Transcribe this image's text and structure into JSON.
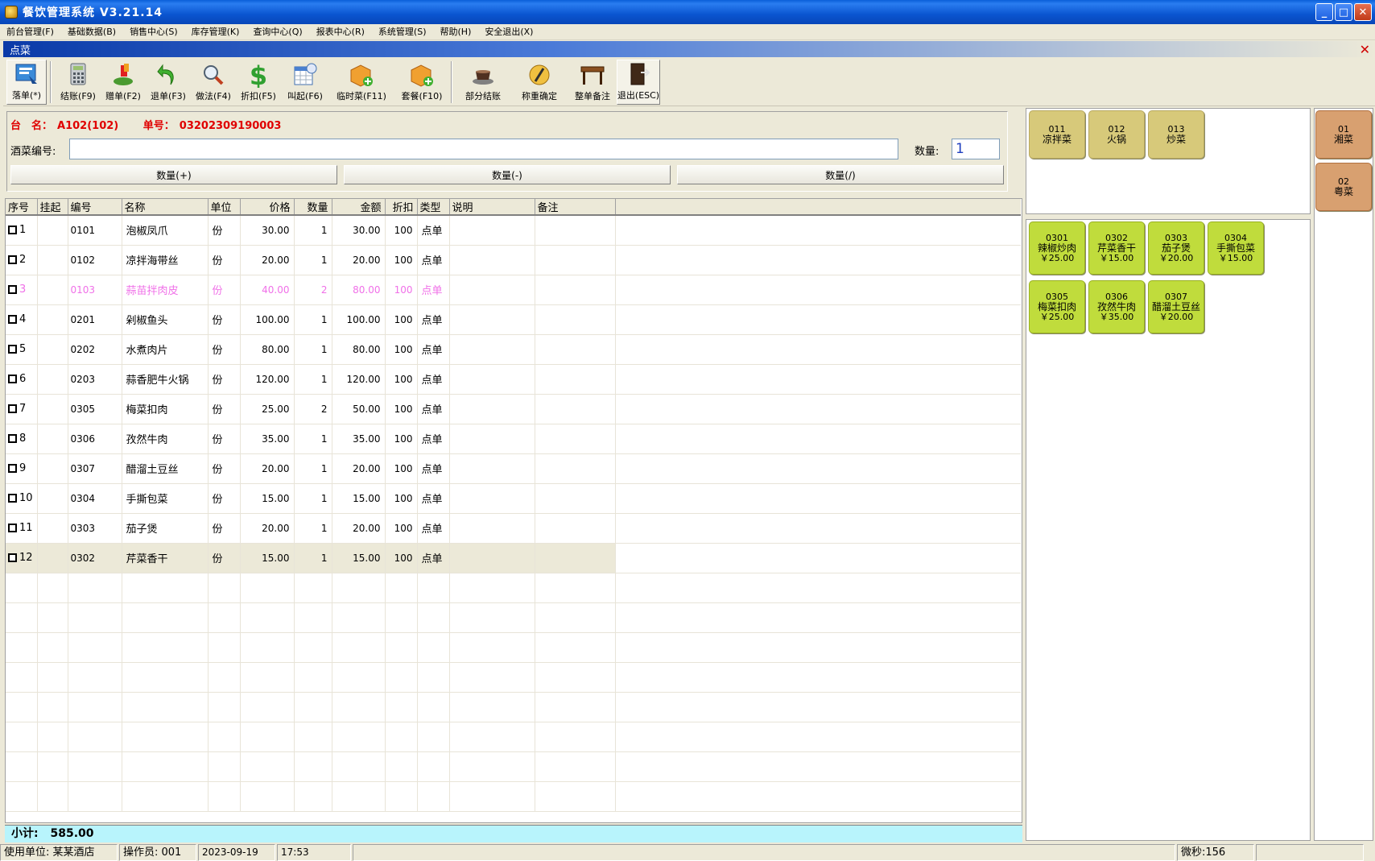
{
  "window": {
    "title": "餐饮管理系统 V3.21.14"
  },
  "menu": [
    "前台管理(F)",
    "基础数据(B)",
    "销售中心(S)",
    "库存管理(K)",
    "查询中心(Q)",
    "报表中心(R)",
    "系统管理(S)",
    "帮助(H)",
    "安全退出(X)"
  ],
  "child": {
    "title": "点菜"
  },
  "toolbar": {
    "buttons": [
      {
        "label": "落单(*)",
        "icon": "order-icon"
      },
      {
        "label": "结账(F9)",
        "icon": "calculator-icon"
      },
      {
        "label": "赠单(F2)",
        "icon": "gift-icon"
      },
      {
        "label": "退单(F3)",
        "icon": "undo-arrow-icon"
      },
      {
        "label": "做法(F4)",
        "icon": "magnifier-icon"
      },
      {
        "label": "折扣(F5)",
        "icon": "dollar-icon"
      },
      {
        "label": "叫起(F6)",
        "icon": "calendar-icon"
      },
      {
        "label": "临时菜(F11)",
        "icon": "box-add-icon"
      },
      {
        "label": "套餐(F10)",
        "icon": "package-add-icon"
      },
      {
        "label": "部分结账",
        "icon": "teacup-icon"
      },
      {
        "label": "称重确定",
        "icon": "scale-icon"
      },
      {
        "label": "整单备注",
        "icon": "table-icon"
      },
      {
        "label": "退出(ESC)",
        "icon": "exit-door-icon"
      }
    ]
  },
  "order": {
    "table_label": "台　名：",
    "table_value": "A102(102)",
    "number_label": "单号：",
    "number_value": "03202309190003",
    "dish_code_label": "酒菜编号:",
    "dish_code_value": "",
    "qty_label": "数量:",
    "qty_value": "1",
    "btn_plus": "数量(+)",
    "btn_minus": "数量(-)",
    "btn_div": "数量(/)"
  },
  "grid": {
    "columns": [
      "序号",
      "挂起",
      "编号",
      "名称",
      "单位",
      "价格",
      "数量",
      "金额",
      "折扣",
      "类型",
      "说明",
      "备注"
    ],
    "rows": [
      {
        "no": "1",
        "code": "0101",
        "name": "泡椒凤爪",
        "unit": "份",
        "price": "30.00",
        "qty": "1",
        "amount": "30.00",
        "discount": "100",
        "type": "点单"
      },
      {
        "no": "2",
        "code": "0102",
        "name": "凉拌海带丝",
        "unit": "份",
        "price": "20.00",
        "qty": "1",
        "amount": "20.00",
        "discount": "100",
        "type": "点单"
      },
      {
        "no": "3",
        "code": "0103",
        "name": "蒜苗拌肉皮",
        "unit": "份",
        "price": "40.00",
        "qty": "2",
        "amount": "80.00",
        "discount": "100",
        "type": "点单",
        "style": "pink"
      },
      {
        "no": "4",
        "code": "0201",
        "name": "剁椒鱼头",
        "unit": "份",
        "price": "100.00",
        "qty": "1",
        "amount": "100.00",
        "discount": "100",
        "type": "点单"
      },
      {
        "no": "5",
        "code": "0202",
        "name": "水煮肉片",
        "unit": "份",
        "price": "80.00",
        "qty": "1",
        "amount": "80.00",
        "discount": "100",
        "type": "点单"
      },
      {
        "no": "6",
        "code": "0203",
        "name": "蒜香肥牛火锅",
        "unit": "份",
        "price": "120.00",
        "qty": "1",
        "amount": "120.00",
        "discount": "100",
        "type": "点单"
      },
      {
        "no": "7",
        "code": "0305",
        "name": "梅菜扣肉",
        "unit": "份",
        "price": "25.00",
        "qty": "2",
        "amount": "50.00",
        "discount": "100",
        "type": "点单"
      },
      {
        "no": "8",
        "code": "0306",
        "name": "孜然牛肉",
        "unit": "份",
        "price": "35.00",
        "qty": "1",
        "amount": "35.00",
        "discount": "100",
        "type": "点单"
      },
      {
        "no": "9",
        "code": "0307",
        "name": "醋溜土豆丝",
        "unit": "份",
        "price": "20.00",
        "qty": "1",
        "amount": "20.00",
        "discount": "100",
        "type": "点单"
      },
      {
        "no": "10",
        "code": "0304",
        "name": "手撕包菜",
        "unit": "份",
        "price": "15.00",
        "qty": "1",
        "amount": "15.00",
        "discount": "100",
        "type": "点单"
      },
      {
        "no": "11",
        "code": "0303",
        "name": "茄子煲",
        "unit": "份",
        "price": "20.00",
        "qty": "1",
        "amount": "20.00",
        "discount": "100",
        "type": "点单"
      },
      {
        "no": "12",
        "code": "0302",
        "name": "芹菜香干",
        "unit": "份",
        "price": "15.00",
        "qty": "1",
        "amount": "15.00",
        "discount": "100",
        "type": "点单",
        "style": "sel"
      }
    ],
    "empty_rows": 8
  },
  "subtotal": {
    "label": "小计:",
    "value": "585.00"
  },
  "status": {
    "unit": "使用单位: 某某酒店",
    "operator": "操作员: 001",
    "date": "2023-09-19",
    "time": "17:53",
    "ms": "微秒:156"
  },
  "categories": [
    {
      "code": "011",
      "name": "凉拌菜"
    },
    {
      "code": "012",
      "name": "火锅"
    },
    {
      "code": "013",
      "name": "炒菜"
    }
  ],
  "dishes": [
    {
      "code": "0301",
      "name": "辣椒炒肉",
      "price": "￥25.00"
    },
    {
      "code": "0302",
      "name": "芹菜香干",
      "price": "￥15.00"
    },
    {
      "code": "0303",
      "name": "茄子煲",
      "price": "￥20.00"
    },
    {
      "code": "0304",
      "name": "手撕包菜",
      "price": "￥15.00"
    },
    {
      "code": "0305",
      "name": "梅菜扣肉",
      "price": "￥25.00"
    },
    {
      "code": "0306",
      "name": "孜然牛肉",
      "price": "￥35.00"
    },
    {
      "code": "0307",
      "name": "醋溜土豆丝",
      "price": "￥20.00"
    }
  ],
  "types": [
    {
      "code": "01",
      "name": "湘菜"
    },
    {
      "code": "02",
      "name": "粤菜"
    }
  ]
}
